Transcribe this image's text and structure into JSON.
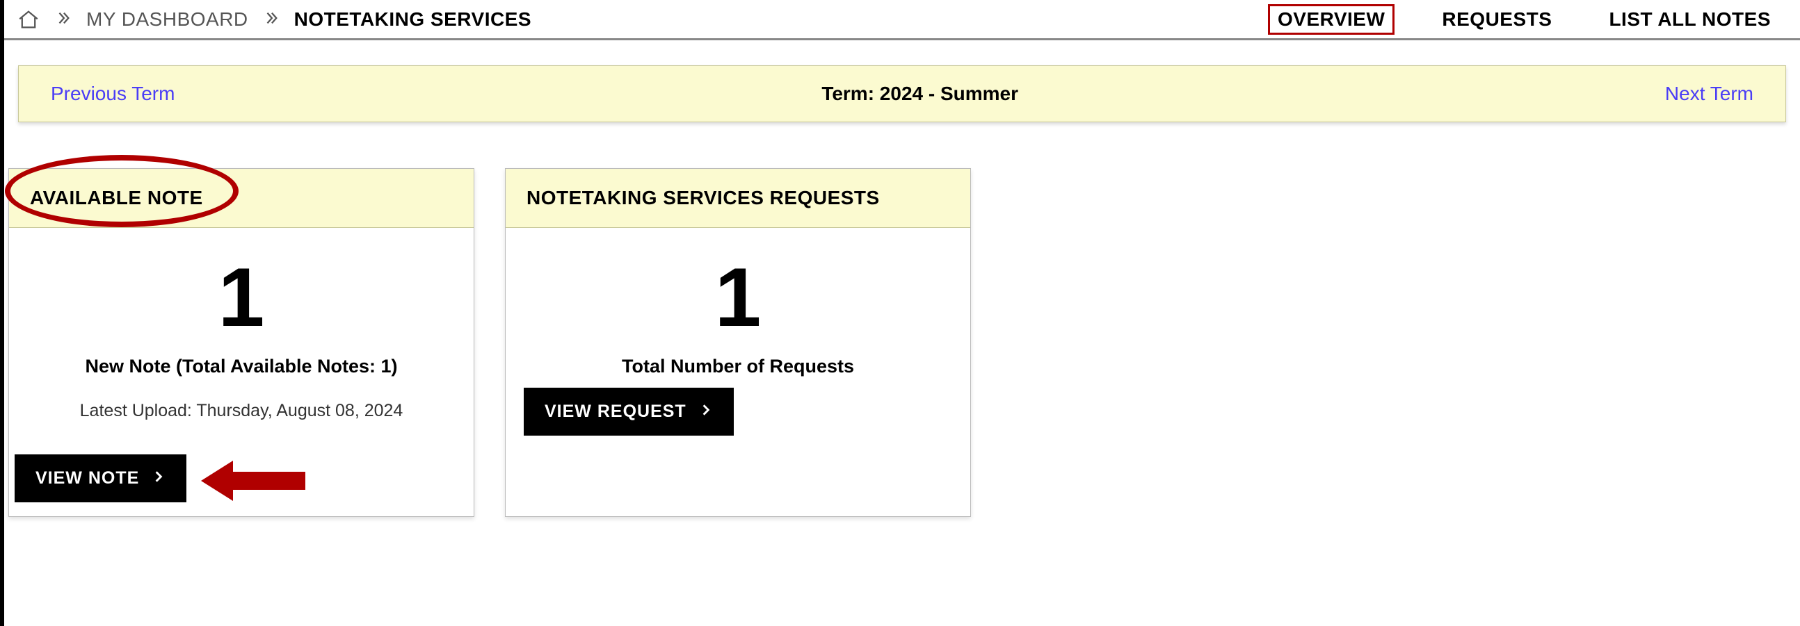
{
  "breadcrumb": {
    "dashboard": "MY DASHBOARD",
    "current": "NOTETAKING SERVICES"
  },
  "tabs": {
    "overview": "OVERVIEW",
    "requests": "REQUESTS",
    "listall": "LIST ALL NOTES"
  },
  "term": {
    "prev": "Previous Term",
    "label": "Term: 2024 - Summer",
    "next": "Next Term"
  },
  "cards": {
    "available": {
      "title": "AVAILABLE NOTE",
      "count": "1",
      "label": "New Note (Total Available Notes: 1)",
      "sub": "Latest Upload: Thursday, August 08, 2024",
      "button": "VIEW NOTE"
    },
    "requests": {
      "title": "NOTETAKING SERVICES REQUESTS",
      "count": "1",
      "label": "Total Number of Requests",
      "button": "VIEW REQUEST"
    }
  }
}
